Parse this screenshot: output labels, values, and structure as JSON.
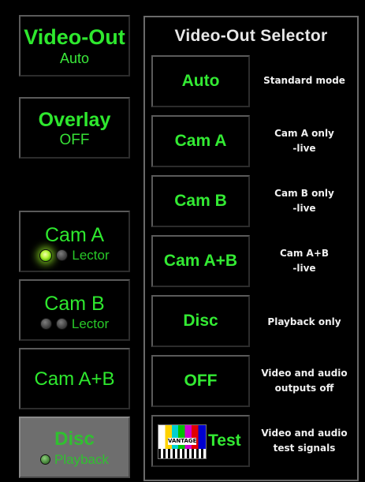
{
  "left_panel": {
    "video_out": {
      "label": "Video-Out",
      "value": "Auto"
    },
    "overlay": {
      "label": "Overlay",
      "value": "OFF"
    },
    "cam_a": {
      "label": "Cam A",
      "indicator_label": "Lector",
      "led_on": [
        true,
        false
      ]
    },
    "cam_b": {
      "label": "Cam B",
      "indicator_label": "Lector",
      "led_on": [
        false,
        false
      ]
    },
    "cam_ab": {
      "label": "Cam A+B"
    },
    "disc": {
      "label": "Disc",
      "indicator_label": "Playback",
      "led_on": [
        false
      ]
    }
  },
  "selector": {
    "title": "Video-Out Selector",
    "options": [
      {
        "label": "Auto",
        "description": "Standard mode"
      },
      {
        "label": "Cam A",
        "description": "Cam A only\n-live"
      },
      {
        "label": "Cam B",
        "description": "Cam B only\n-live"
      },
      {
        "label": "Cam A+B",
        "description": "Cam A+B\n-live"
      },
      {
        "label": "Disc",
        "description": "Playback only"
      },
      {
        "label": "OFF",
        "description": "Video and audio\noutputs off"
      },
      {
        "label": "Test",
        "description": "Video and audio\ntest signals",
        "thumbnail_text": "VANTAGE"
      }
    ]
  },
  "colors": {
    "active_text": "#2ee82e",
    "disabled_bg": "#6e6e6e",
    "disabled_text": "#2cc82c"
  }
}
